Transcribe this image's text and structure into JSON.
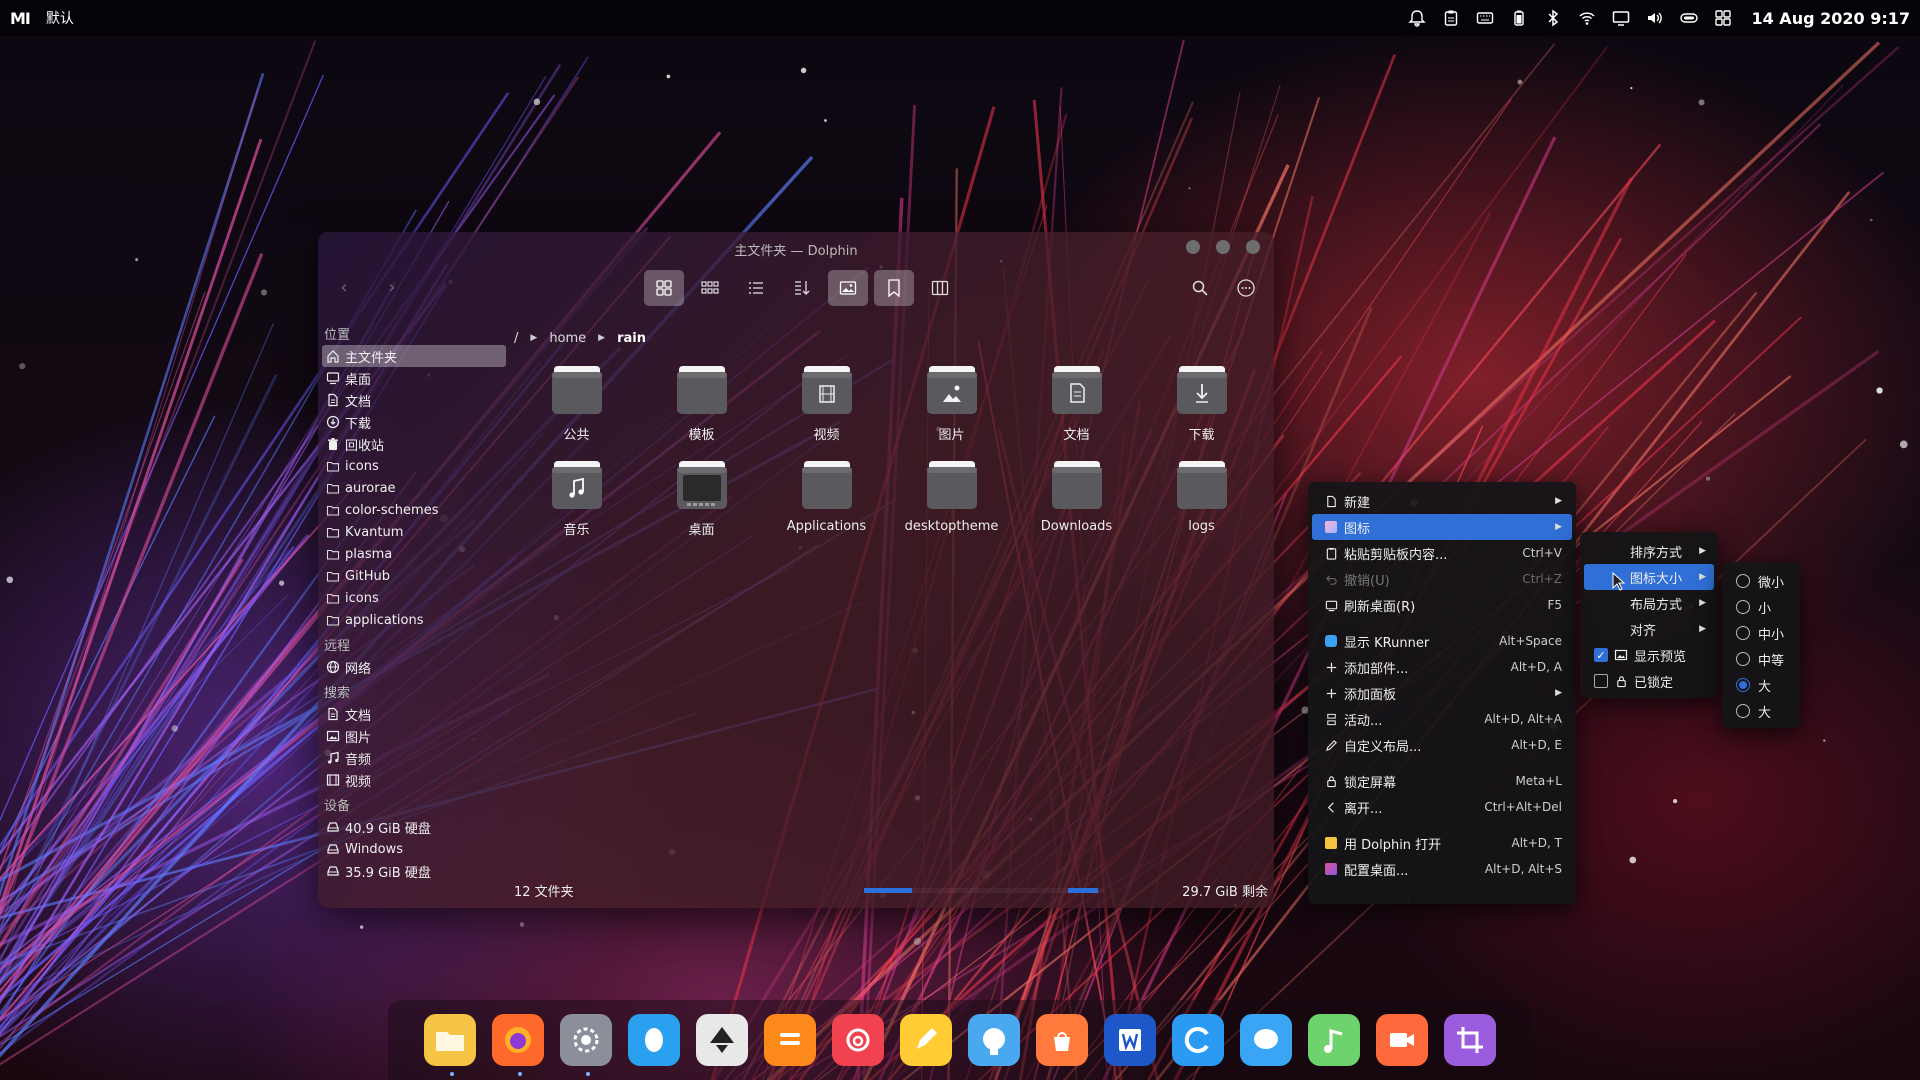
{
  "top_panel": {
    "logo": "MI",
    "workspace": "默认",
    "clock": "14 Aug 2020 9:17",
    "tray_icons": [
      "bell-icon",
      "clipboard-icon",
      "keyboard-icon",
      "battery-icon",
      "bluetooth-icon",
      "wifi-icon",
      "display-icon",
      "volume-icon",
      "toggle-icon",
      "grid-icon"
    ]
  },
  "dolphin": {
    "title": "主文件夹 — Dolphin",
    "sidebar": {
      "sections": [
        {
          "title": "位置",
          "items": [
            {
              "label": "主文件夹",
              "icon": "home-icon",
              "selected": true
            },
            {
              "label": "桌面",
              "icon": "desktop-icon"
            },
            {
              "label": "文档",
              "icon": "document-icon"
            },
            {
              "label": "下载",
              "icon": "download-icon"
            },
            {
              "label": "回收站",
              "icon": "trash-icon"
            },
            {
              "label": "icons",
              "icon": "folder-icon"
            },
            {
              "label": "aurorae",
              "icon": "folder-icon"
            },
            {
              "label": "color-schemes",
              "icon": "folder-icon"
            },
            {
              "label": "Kvantum",
              "icon": "folder-icon"
            },
            {
              "label": "plasma",
              "icon": "folder-icon"
            },
            {
              "label": "GitHub",
              "icon": "folder-icon"
            },
            {
              "label": "icons",
              "icon": "folder-icon"
            },
            {
              "label": "applications",
              "icon": "folder-icon"
            }
          ]
        },
        {
          "title": "远程",
          "items": [
            {
              "label": "网络",
              "icon": "network-icon"
            }
          ]
        },
        {
          "title": "搜索",
          "items": [
            {
              "label": "文档",
              "icon": "document-icon"
            },
            {
              "label": "图片",
              "icon": "image-icon"
            },
            {
              "label": "音频",
              "icon": "music-icon"
            },
            {
              "label": "视频",
              "icon": "video-icon"
            }
          ]
        },
        {
          "title": "设备",
          "items": [
            {
              "label": "40.9 GiB 硬盘",
              "icon": "drive-icon"
            },
            {
              "label": "Windows",
              "icon": "drive-icon"
            },
            {
              "label": "35.9 GiB 硬盘",
              "icon": "drive-icon"
            }
          ]
        }
      ]
    },
    "breadcrumb": {
      "root": "/",
      "parts": [
        "home",
        "rain"
      ]
    },
    "files": [
      {
        "name": "公共",
        "emblem": ""
      },
      {
        "name": "模板",
        "emblem": ""
      },
      {
        "name": "视频",
        "emblem": "video"
      },
      {
        "name": "图片",
        "emblem": "image"
      },
      {
        "name": "文档",
        "emblem": "document"
      },
      {
        "name": "下载",
        "emblem": "download"
      },
      {
        "name": "音乐",
        "emblem": "music"
      },
      {
        "name": "桌面",
        "emblem": "desktop"
      },
      {
        "name": "Applications",
        "emblem": ""
      },
      {
        "name": "desktoptheme",
        "emblem": ""
      },
      {
        "name": "Downloads",
        "emblem": ""
      },
      {
        "name": "logs",
        "emblem": ""
      }
    ],
    "status": {
      "count": "12 文件夹",
      "free_space": "29.7 GiB 剩余",
      "used_fraction": 0.2
    }
  },
  "context_menu": {
    "groups": [
      [
        {
          "label": "新建",
          "icon": "new-file-icon",
          "shortcut": "",
          "submenu": true
        },
        {
          "label": "图标",
          "icon": "icons-icon",
          "shortcut": "",
          "submenu": true,
          "highlighted": true
        },
        {
          "label": "粘贴剪贴板内容...",
          "icon": "paste-icon",
          "shortcut": "Ctrl+V"
        },
        {
          "label": "撤销(U)",
          "icon": "undo-icon",
          "shortcut": "Ctrl+Z",
          "disabled": true
        },
        {
          "label": "刷新桌面(R)",
          "icon": "refresh-icon",
          "shortcut": "F5"
        }
      ],
      [
        {
          "label": "显示 KRunner",
          "icon": "krunner-icon",
          "shortcut": "Alt+Space"
        },
        {
          "label": "添加部件...",
          "icon": "plus-icon",
          "shortcut": "Alt+D, A"
        },
        {
          "label": "添加面板",
          "icon": "plus-icon",
          "shortcut": "",
          "submenu": true
        },
        {
          "label": "活动...",
          "icon": "activities-icon",
          "shortcut": "Alt+D, Alt+A"
        },
        {
          "label": "自定义布局...",
          "icon": "edit-icon",
          "shortcut": "Alt+D, E"
        }
      ],
      [
        {
          "label": "锁定屏幕",
          "icon": "lock-icon",
          "shortcut": "Meta+L"
        },
        {
          "label": "离开...",
          "icon": "leave-icon",
          "shortcut": "Ctrl+Alt+Del"
        }
      ],
      [
        {
          "label": "用 Dolphin 打开",
          "icon": "dolphin-icon",
          "shortcut": "Alt+D, T"
        },
        {
          "label": "配置桌面...",
          "icon": "configure-icon",
          "shortcut": "Alt+D, Alt+S"
        }
      ]
    ]
  },
  "icons_submenu": {
    "items": [
      {
        "label": "排序方式",
        "submenu": true
      },
      {
        "label": "图标大小",
        "submenu": true,
        "highlighted": true
      },
      {
        "label": "布局方式",
        "submenu": true
      },
      {
        "label": "对齐",
        "submenu": true
      }
    ],
    "checks": [
      {
        "label": "显示预览",
        "checked": true
      },
      {
        "label": "已锁定",
        "checked": false
      }
    ]
  },
  "icon_size_submenu": {
    "options": [
      {
        "label": "微小",
        "selected": false
      },
      {
        "label": "小",
        "selected": false
      },
      {
        "label": "中小",
        "selected": false
      },
      {
        "label": "中等",
        "selected": false
      },
      {
        "label": "大",
        "selected": true
      },
      {
        "label": "大",
        "selected": false
      }
    ]
  },
  "dock": {
    "apps": [
      {
        "name": "files-icon",
        "color": "#f6c445",
        "running": true
      },
      {
        "name": "firefox-icon",
        "color": "#ff6a2a",
        "running": true
      },
      {
        "name": "settings-icon",
        "color": "#8a8f99",
        "running": true
      },
      {
        "name": "qq-icon",
        "color": "#2aa0f0",
        "running": false
      },
      {
        "name": "inkscape-icon",
        "color": "#e8e8e8",
        "running": false
      },
      {
        "name": "notes-icon",
        "color": "#ff8a1c",
        "running": false
      },
      {
        "name": "netease-music-icon",
        "color": "#f0434f",
        "running": false
      },
      {
        "name": "editor-icon",
        "color": "#ffcc33",
        "running": false
      },
      {
        "name": "github-icon",
        "color": "#4aa8f0",
        "running": false
      },
      {
        "name": "shop-icon",
        "color": "#ff7a3c",
        "running": false
      },
      {
        "name": "word-icon",
        "color": "#1e58c8",
        "running": false
      },
      {
        "name": "browser-c-icon",
        "color": "#2b9af3",
        "running": false
      },
      {
        "name": "chat-icon",
        "color": "#3aa4f5",
        "running": false
      },
      {
        "name": "music-app-icon",
        "color": "#6ed36e",
        "running": false
      },
      {
        "name": "video-call-icon",
        "color": "#ff6a3c",
        "running": false
      },
      {
        "name": "crop-icon",
        "color": "#9c5ce0",
        "running": false
      }
    ]
  }
}
